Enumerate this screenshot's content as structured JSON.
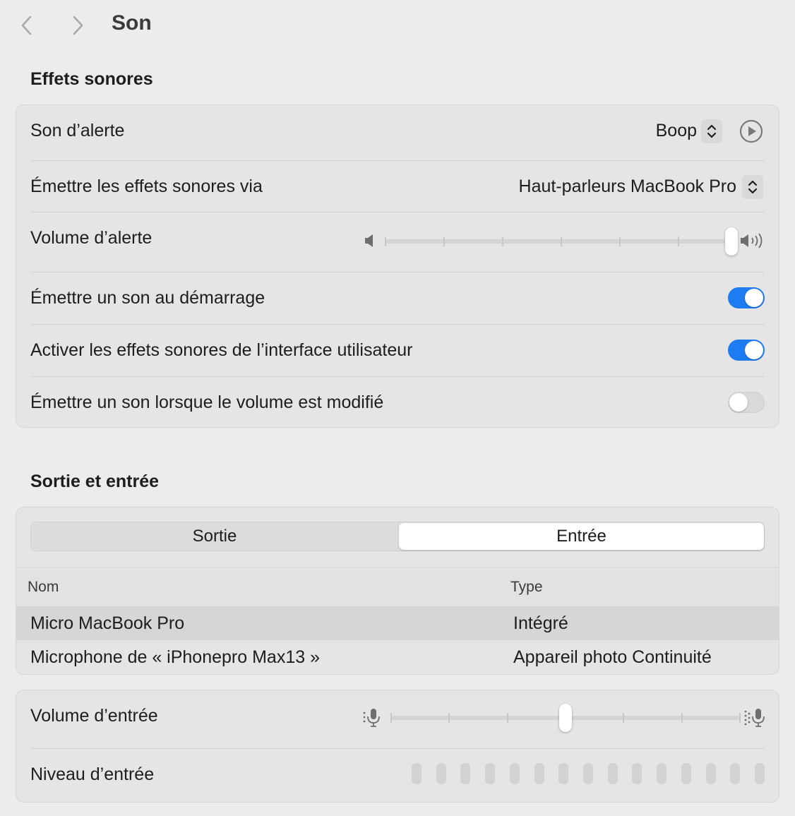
{
  "window": {
    "title": "Son"
  },
  "effects": {
    "section_title": "Effets sonores",
    "alert_sound": {
      "label": "Son d’alerte",
      "value": "Boop"
    },
    "play_via": {
      "label": "Émettre les effets sonores via",
      "value": "Haut-parleurs MacBook Pro"
    },
    "alert_volume": {
      "label": "Volume d’alerte",
      "level": 1.0,
      "ticks": 7
    },
    "startup_sound": {
      "label": "Émettre un son au démarrage",
      "enabled": true
    },
    "ui_sounds": {
      "label": "Activer les effets sonores de l’interface utilisateur",
      "enabled": true
    },
    "volume_feedback": {
      "label": "Émettre un son lorsque le volume est modifié",
      "enabled": false
    }
  },
  "io": {
    "section_title": "Sortie et entrée",
    "tabs": [
      {
        "label": "Sortie",
        "selected": false
      },
      {
        "label": "Entrée",
        "selected": true
      }
    ],
    "table": {
      "headers": {
        "name": "Nom",
        "type": "Type"
      },
      "rows": [
        {
          "name": "Micro MacBook Pro",
          "type": "Intégré",
          "selected": true
        },
        {
          "name": "Microphone de « iPhonepro Max13 »",
          "type": "Appareil photo Continuité",
          "selected": false
        }
      ]
    }
  },
  "input": {
    "volume": {
      "label": "Volume d’entrée",
      "level": 0.5,
      "ticks": 7
    },
    "level": {
      "label": "Niveau d’entrée",
      "segments": 15,
      "active": 0
    }
  },
  "colors": {
    "accent": "#1e7cf2",
    "background": "#ececec",
    "card": "#e5e5e5"
  },
  "icons": [
    "chevron-left-icon",
    "chevron-right-icon",
    "play-circle-icon",
    "speaker-low-icon",
    "speaker-high-icon",
    "mic-low-icon",
    "mic-high-icon",
    "stepper-icon"
  ]
}
